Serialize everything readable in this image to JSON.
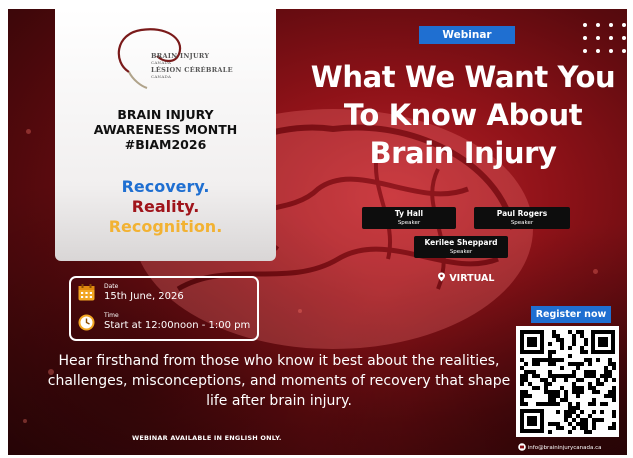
{
  "panel": {
    "logo_line1": "BRAIN INJURY",
    "logo_line2": "CANADA",
    "logo_line3": "LÉSION CÉRÉBRALE",
    "logo_line4": "CANADA",
    "heading_line1": "BRAIN INJURY",
    "heading_line2": "AWARENESS MONTH",
    "heading_line3": "#BIAM2026",
    "tag1": "Recovery.",
    "tag2": "Reality.",
    "tag3": "Recognition."
  },
  "webinar_label": "Webinar",
  "title_line1": "What We Want You",
  "title_line2": "To Know About",
  "title_line3": "Brain Injury",
  "speakers": [
    {
      "name": "Ty Hall",
      "role": "Speaker"
    },
    {
      "name": "Paul Rogers",
      "role": "Speaker"
    },
    {
      "name": "Kerilee Sheppard",
      "role": "Speaker"
    }
  ],
  "virtual_label": "VIRTUAL",
  "event": {
    "date_label": "Date",
    "date_value": "15th June, 2026",
    "time_label": "Time",
    "time_value": "Start at 12:00noon - 1:00 pm"
  },
  "description": "Hear firsthand from those who know it best about the realities, challenges, misconceptions, and moments of recovery that shape life after brain injury.",
  "footer_note": "WEBINAR AVAILABLE IN ENGLISH ONLY.",
  "register_label": "Register now",
  "contact_email": "info@braininjurycanada.ca",
  "colors": {
    "background_red": "#8e1218",
    "accent_blue": "#1f6fd1",
    "recovery_blue": "#1f6fd1",
    "reality_red": "#a0141b",
    "recognition_yellow": "#f2b233"
  },
  "icons": [
    "calendar-icon",
    "clock-icon",
    "location-pin-icon",
    "mail-icon",
    "qr-code"
  ]
}
